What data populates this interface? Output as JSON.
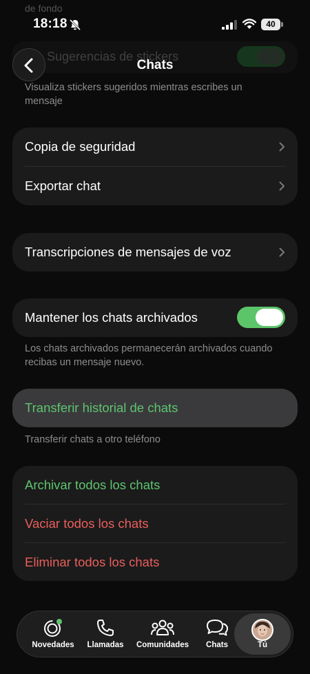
{
  "status_bar": {
    "time": "18:18",
    "battery": "40"
  },
  "ghost": {
    "top_text": "de fondo",
    "row_label": "Sugerencias de stickers"
  },
  "header": {
    "title": "Chats"
  },
  "stickers": {
    "description": "Visualiza stickers sugeridos mientras escribes un mensaje"
  },
  "backup_card": {
    "items": [
      {
        "label": "Copia de seguridad"
      },
      {
        "label": "Exportar chat"
      }
    ]
  },
  "voice_card": {
    "label": "Transcripciones de mensajes de voz"
  },
  "archived": {
    "label": "Mantener los chats archivados",
    "enabled": true,
    "description": "Los chats archivados permanecerán archivados cuando recibas un mensaje nuevo."
  },
  "transfer": {
    "label": "Transferir historial de chats",
    "description": "Transferir chats a otro teléfono"
  },
  "actions_card": {
    "archive_all": "Archivar todos los chats",
    "clear_all": "Vaciar todos los chats",
    "delete_all": "Eliminar todos los chats"
  },
  "tab_bar": {
    "tabs": [
      {
        "label": "Novedades",
        "icon": "status-icon"
      },
      {
        "label": "Llamadas",
        "icon": "phone-icon"
      },
      {
        "label": "Comunidades",
        "icon": "communities-icon"
      },
      {
        "label": "Chats",
        "icon": "chats-icon"
      },
      {
        "label": "Tú",
        "icon": "avatar"
      }
    ],
    "active": "Tú"
  },
  "colors": {
    "accent_green": "#5ec46f",
    "danger_red": "#e95f5c",
    "toggle_green": "#5cc56a"
  }
}
